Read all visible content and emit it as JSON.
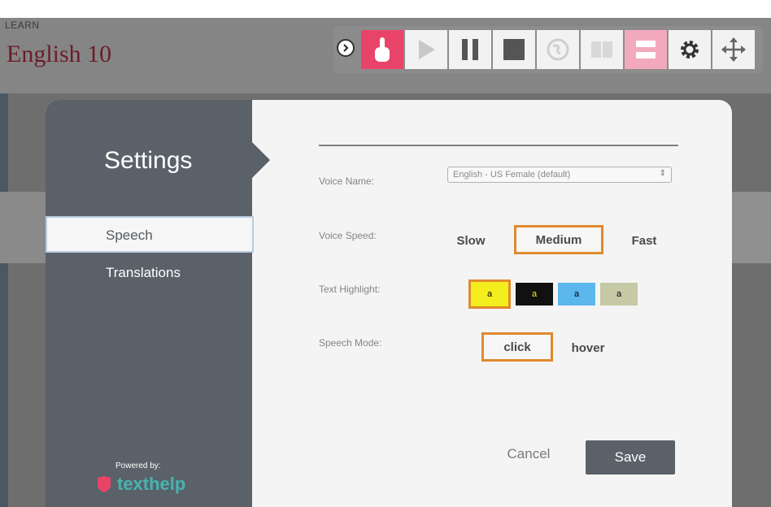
{
  "app": {
    "section_label": "LEARN",
    "title": "English 10"
  },
  "toolbar": {
    "items": [
      {
        "name": "collapse",
        "icon": "chevron-right-circle-icon"
      },
      {
        "name": "click-mode",
        "icon": "pointer-hand-icon"
      },
      {
        "name": "play",
        "icon": "play-icon"
      },
      {
        "name": "pause",
        "icon": "pause-icon"
      },
      {
        "name": "stop",
        "icon": "stop-icon"
      },
      {
        "name": "translate",
        "icon": "globe-icon"
      },
      {
        "name": "dictionary",
        "icon": "book-icon"
      },
      {
        "name": "screen-mask",
        "icon": "screen-mask-icon"
      },
      {
        "name": "settings",
        "icon": "gear-icon"
      },
      {
        "name": "move",
        "icon": "move-arrows-icon"
      }
    ],
    "accent": "#e8446a"
  },
  "settings": {
    "title": "Settings",
    "nav": {
      "speech": "Speech",
      "translations": "Translations"
    },
    "voice_name_label": "Voice Name:",
    "voice_name_value": "English - US Female (default)",
    "voice_speed_label": "Voice Speed:",
    "speed_options": {
      "slow": "Slow",
      "medium": "Medium",
      "fast": "Fast"
    },
    "speed_selected": "Medium",
    "text_highlight_label": "Text Highlight:",
    "highlights": [
      {
        "text": "a",
        "bg": "#f4ee1e",
        "fg": "#000000",
        "selected": true
      },
      {
        "text": "a",
        "bg": "#111111",
        "fg": "#f4ee1e",
        "selected": false
      },
      {
        "text": "a",
        "bg": "#5bb7ec",
        "fg": "#000000",
        "selected": false
      },
      {
        "text": "a",
        "bg": "#c5c9a5",
        "fg": "#000000",
        "selected": false
      }
    ],
    "speech_mode_label": "Speech Mode:",
    "mode_options": {
      "click": "click",
      "hover": "hover"
    },
    "mode_selected": "click",
    "cancel_label": "Cancel",
    "save_label": "Save",
    "powered_by": "Powered by:",
    "brand": "texthelp",
    "highlight_color": "#e08a2e"
  }
}
